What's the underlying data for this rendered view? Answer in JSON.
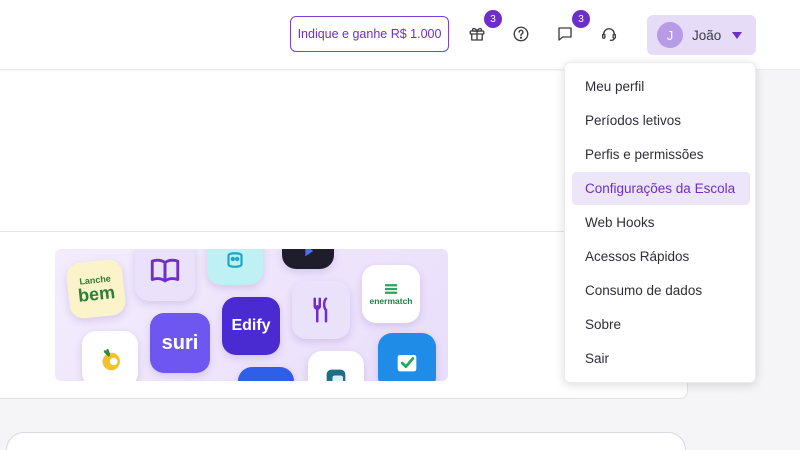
{
  "header": {
    "referral_label": "Indique e ganhe R$ 1.000",
    "gift_badge": "3",
    "chat_badge": "3",
    "user": {
      "initial": "J",
      "name": "João"
    }
  },
  "user_menu": {
    "items": [
      {
        "label": "Meu perfil",
        "active": false
      },
      {
        "label": "Períodos letivos",
        "active": false
      },
      {
        "label": "Perfis e permissões",
        "active": false
      },
      {
        "label": "Configurações da Escola",
        "active": true
      },
      {
        "label": "Web Hooks",
        "active": false
      },
      {
        "label": "Acessos Rápidos",
        "active": false
      },
      {
        "label": "Consumo de dados",
        "active": false
      },
      {
        "label": "Sobre",
        "active": false
      },
      {
        "label": "Sair",
        "active": false
      }
    ]
  },
  "banner": {
    "apps": {
      "lanche_bem": [
        "Lanche",
        "bem"
      ],
      "suri": "suri",
      "edify": "Edify",
      "enermatch": "enermatch"
    }
  },
  "colors": {
    "accent": "#6d2fc8",
    "accent_light": "#e6dcf7"
  }
}
